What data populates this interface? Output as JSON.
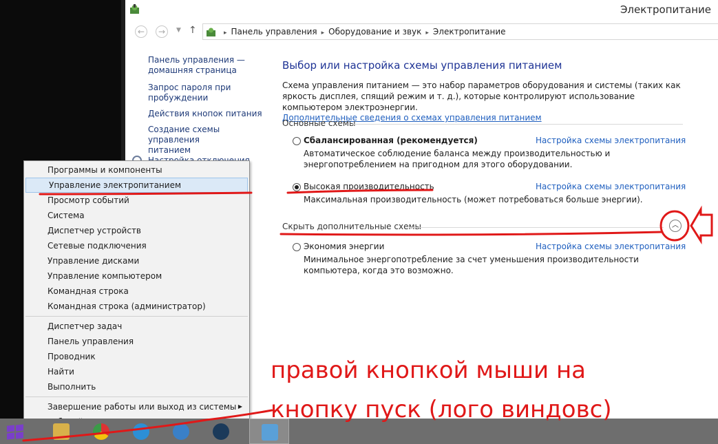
{
  "window": {
    "title": "Электропитание"
  },
  "navigation": {
    "back": "←",
    "forward": "→",
    "dropdown": "▼",
    "up": "↑",
    "breadcrumbs": [
      "Панель управления",
      "Оборудование и звук",
      "Электропитание"
    ],
    "separator": "▸"
  },
  "sidebar": {
    "items": [
      {
        "label": "Панель управления —\nдомашняя страница"
      },
      {
        "label": "Запрос пароля при\nпробуждении"
      },
      {
        "label": "Действия кнопок питания"
      },
      {
        "label": "Создание схемы управления\nпитанием"
      }
    ],
    "hidden_item": "Настройка отключения"
  },
  "main": {
    "heading": "Выбор или настройка схемы управления питанием",
    "intro": "Схема управления питанием — это набор параметров оборудования и системы (таких как яркость дисплея, спящий режим и т. д.), которые контролируют использование компьютером электроэнергии.",
    "intro_link": "Дополнительные сведения о схемах управления питанием",
    "preferred_header": "Основные схемы",
    "hidden_header": "Скрыть дополнительные схемы",
    "plans": [
      {
        "name": "Сбалансированная (рекомендуется)",
        "selected": false,
        "link": "Настройка схемы электропитания",
        "description": "Автоматическое соблюдение баланса между производительностью и энергопотреблением на пригодном для этого оборудовании."
      },
      {
        "name": "Высокая производительность",
        "selected": true,
        "link": "Настройка схемы электропитания",
        "description": "Максимальная производительность (может потребоваться больше энергии)."
      },
      {
        "name": "Экономия энергии",
        "selected": false,
        "link": "Настройка схемы электропитания",
        "description": "Минимальное энергопотребление за счет уменьшения производительности компьютера, когда это возможно."
      }
    ]
  },
  "context_menu": {
    "group1": [
      "Программы и компоненты",
      "Управление электропитанием",
      "Просмотр событий",
      "Система",
      "Диспетчер устройств",
      "Сетевые подключения",
      "Управление дисками",
      "Управление компьютером",
      "Командная строка",
      "Командная строка (администратор)"
    ],
    "group2": [
      "Диспетчер задач",
      "Панель управления",
      "Проводник",
      "Найти",
      "Выполнить"
    ],
    "group3": [
      "Завершение работы или выход из системы",
      "Рабочий стол"
    ],
    "highlighted": "Управление электропитанием",
    "submenu_arrow": "▶"
  },
  "annotation": {
    "line1": "правой кнопкой мыши на",
    "line2": "кнопку пуск (лого виндовс)",
    "color": "#e01818"
  },
  "colors": {
    "link": "#1f5fbf",
    "heading": "#1e3395",
    "menu_highlight": "#dbe9f7",
    "taskbar": "#6e6e6e",
    "start": "#7a3fc9"
  }
}
